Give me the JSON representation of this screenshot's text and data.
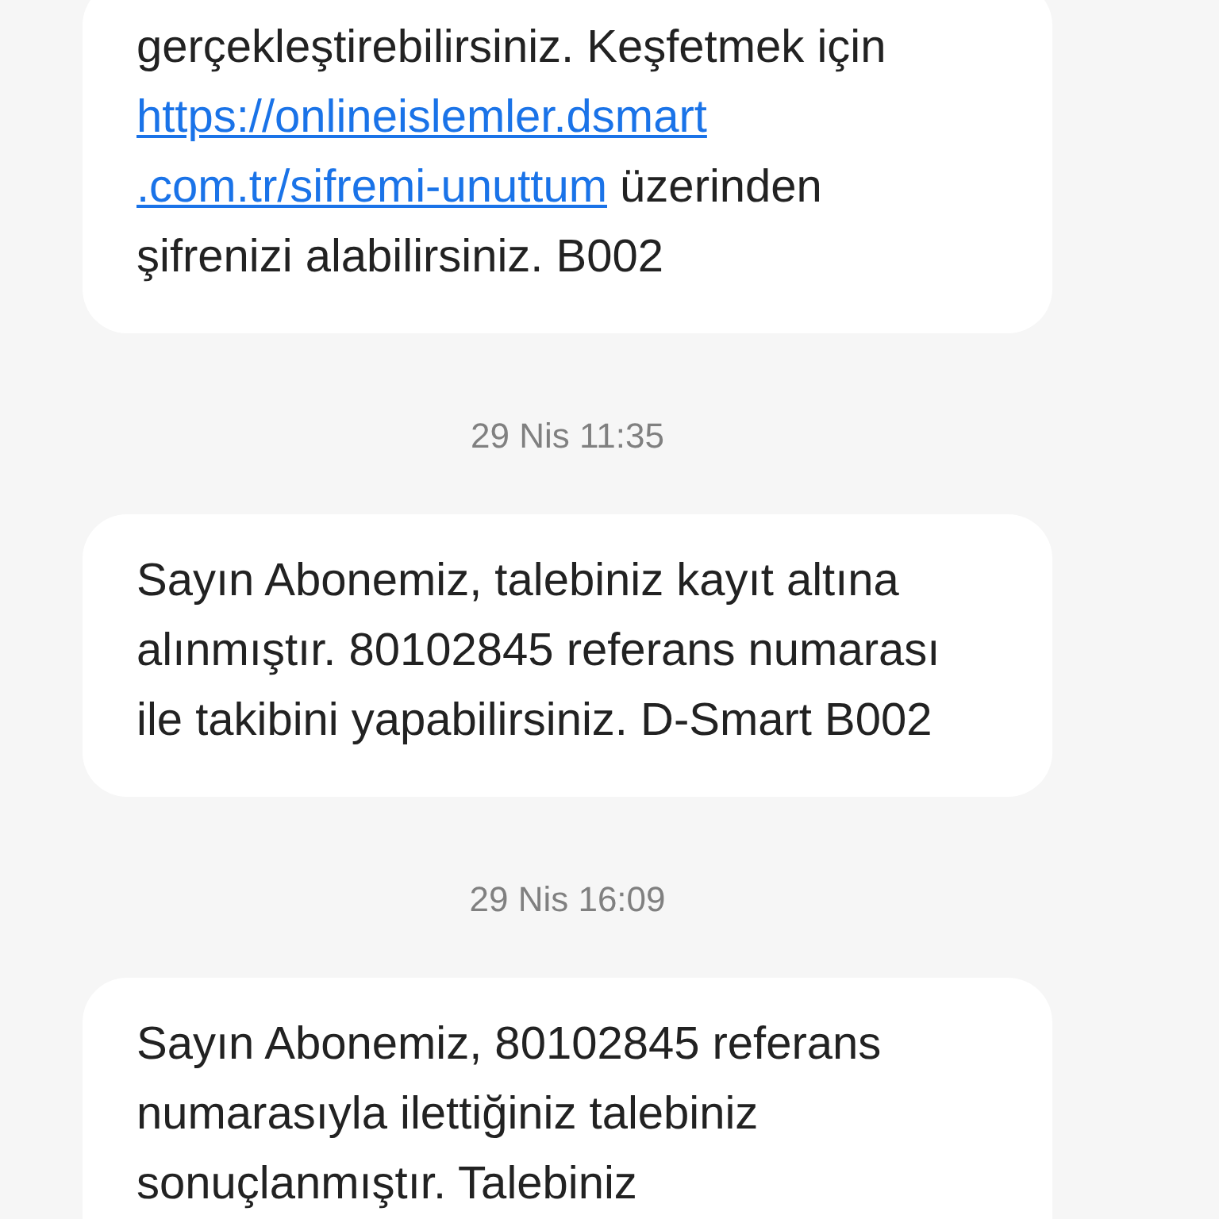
{
  "messages": [
    {
      "kind": "message",
      "parts": [
        {
          "kind": "text",
          "text": "gerçekleştirebilirsiniz. Keşfetmek için "
        },
        {
          "kind": "link",
          "text": "https://onlineislemler.dsmart"
        },
        {
          "kind": "link",
          "text": ".com.tr/sifremi-unuttum"
        },
        {
          "kind": "text",
          "text": " üzerinden şifrenizi alabilirsiniz. B002"
        }
      ]
    },
    {
      "kind": "time",
      "text": "29 Nis 11:35"
    },
    {
      "kind": "message",
      "parts": [
        {
          "kind": "text",
          "text": "Sayın Abonemiz, talebiniz kayıt altına alınmıştır. 80102845 referans numarası ile takibini yapabilirsiniz. D-Smart B002"
        }
      ]
    },
    {
      "kind": "time",
      "text": "29 Nis 16:09"
    },
    {
      "kind": "message",
      "parts": [
        {
          "kind": "text",
          "text": "Sayın Abonemiz, 80102845 referans numarasıyla ilettiğiniz talebiniz sonuçlanmıştır. Talebiniz"
        }
      ]
    }
  ]
}
